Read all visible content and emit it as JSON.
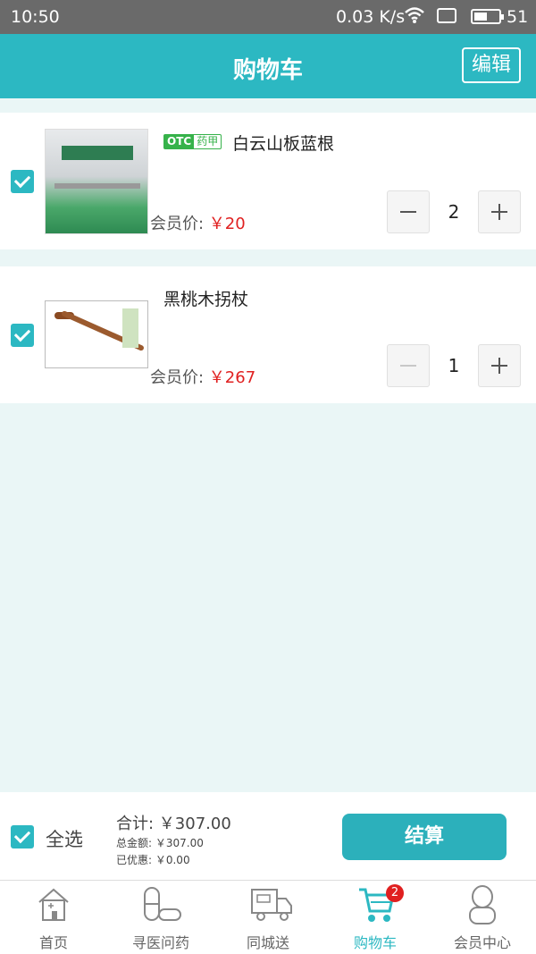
{
  "status_bar": {
    "time": "10:50",
    "network_speed": "0.03 K/s",
    "battery": "51"
  },
  "header": {
    "title": "购物车",
    "edit_label": "编辑"
  },
  "cart_items": [
    {
      "badge_otc": "OTC",
      "badge_type": "药甲",
      "name": "白云山板蓝根",
      "price_label": "会员价: ",
      "price": "￥20",
      "quantity": "2"
    },
    {
      "name": "黑桃木拐杖",
      "price_label": "会员价: ",
      "price": "￥267",
      "quantity": "1"
    }
  ],
  "summary": {
    "select_all": "全选",
    "total": "合计: ￥307.00",
    "gross": "总金额: ￥307.00",
    "discount": "已优惠: ￥0.00",
    "checkout": "结算"
  },
  "tabs": [
    {
      "label": "首页",
      "icon": "home-icon"
    },
    {
      "label": "寻医问药",
      "icon": "pill-icon"
    },
    {
      "label": "同城送",
      "icon": "truck-icon"
    },
    {
      "label": "购物车",
      "icon": "cart-icon",
      "badge": "2",
      "active": true
    },
    {
      "label": "会员中心",
      "icon": "user-icon"
    }
  ],
  "colors": {
    "accent": "#2cb8c2",
    "price": "#e02020",
    "otc_green": "#36b24a",
    "background": "#eaf6f6"
  }
}
